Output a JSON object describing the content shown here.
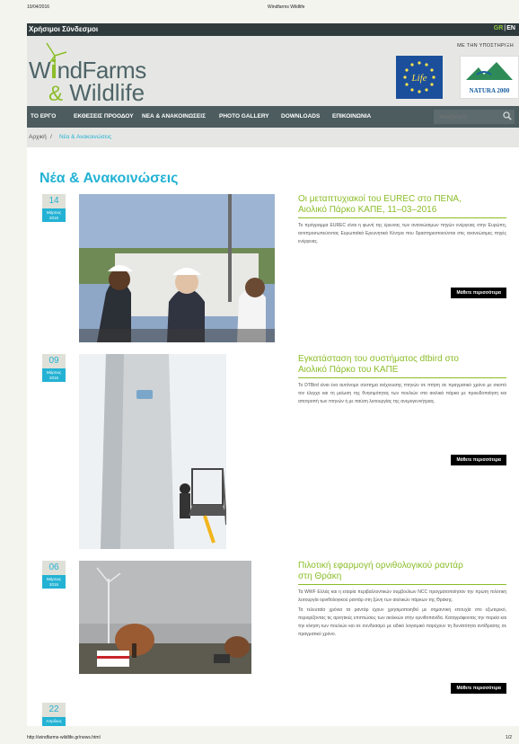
{
  "print": {
    "date": "10/04/2016",
    "title": "Windfarms Wildlife",
    "url": "http://windfarms-wildlife.gr/news.html",
    "page": "1/2"
  },
  "topbar": {
    "useful_links": "Χρήσιμοι Σύνδεσμοι",
    "lang_gr": "GR",
    "lang_sep": "|",
    "lang_en": "EN"
  },
  "brand": {
    "logo_line1_prefix": "W",
    "logo_line1_accent": "i",
    "logo_line1_rest": "ndFarms",
    "logo_line2_amp": "&",
    "logo_line2_rest": " Wildlife",
    "support_label": "ΜΕ ΤΗΝ ΥΠΟΣΤΗΡΙΞΗ",
    "eu_logo_text": "Life",
    "natura_logo_text": "NATURA 2000"
  },
  "nav": {
    "items": [
      "ΤΟ ΕΡΓΟ",
      "ΕΚΘΕΣΕΙΣ ΠΡΟΟΔΟΥ",
      "ΝΕΑ & ΑΝΑΚΟΙΝΩΣΕΙΣ",
      "PHOTO GALLERY",
      "DOWNLOADS",
      "ΕΠΙΚΟΙΝΩΝΙΑ"
    ],
    "search_placeholder": "Αναζήτηση"
  },
  "breadcrumb": {
    "home": "Αρχική",
    "sep": "/",
    "current": "Νέα & Ανακοινώσεις"
  },
  "page_title": "Νέα & Ανακοινώσεις",
  "colors": {
    "accent_blue": "#23b2d4",
    "accent_green": "#8bbd28",
    "nav_bg": "#4c5c5f",
    "topbar_bg": "#2f3a3d"
  },
  "posts": [
    {
      "day": "14",
      "month": "Μάρτιος",
      "year": "2016",
      "title_line1": "Οι μεταπτυχιακοί του EUREC στο ΠΕΝΑ,",
      "title_line2": "Αιολικό Πάρκο ΚΑΠΕ, 11–03–2016",
      "excerpt": "Το πρόγραμμα EUREC είναι η φωνή της έρευνας των ανανεώσιμων πηγών ενέργειας στην Ευρώπη, αντιπροσωπεύοντας Ευρωπαϊκά Ερευνητικά Κέντρα που δραστηριοποιούνται στις ανανεώσιμες πηγές ενέργειας.",
      "more": "Μάθετε περισσότερα"
    },
    {
      "day": "09",
      "month": "Μάρτιος",
      "year": "2016",
      "title_line1": "Εγκατάσταση του συστήματος dtbird στο",
      "title_line2": "Αιολικό Πάρκο του ΚΑΠΕ",
      "excerpt": "Το DTBird είναι ένα αυτόνομο σύστημα ανίχνευσης πτηνών σε πτήση σε πραγματικό χρόνο με σκοπό τον έλεγχο και τη μείωση της θνησιμότητας των πουλιών στα αιολικά πάρκα με προειδοποίηση και αποτροπή των πτηνών ή με παύση λειτουργίας της ανεμογεννήτριας.",
      "more": "Μάθετε περισσότερα"
    },
    {
      "day": "06",
      "month": "Μάρτιος",
      "year": "2016",
      "title_line1": "Πιλοτική εφαρμογή ορνιθολογικού ραντάρ",
      "title_line2": "στη Θράκη",
      "excerpt": "Τα WWF Ελλάς και η εταιρία περιβαλλοντικών συμβούλων NCC πραγματοποίησαν την πρώτη πιλοτική λειτουργία ορνιθολογικού ραντάρ στη ζώνη των αιολικών πάρκων της Θράκης.",
      "excerpt2": "Τα τελευταία χρόνια τα ραντάρ έχουν χρησιμοποιηθεί με σημαντική επιτυχία στο εξωτερικό, περιορίζοντας τις αρνητικές επιπτώσεις των αιολικών στην ορνιθοπανίδα. Καταγράφοντας την πορεία και την κίνηση των πουλιών και σε συνδυασμό με ειδικό λογισμικό παρέχουν τη δυνατότητα αντίδρασης σε πραγματικό χρόνο.",
      "more": "Μάθετε περισσότερα"
    },
    {
      "day": "22",
      "month": "Απρίλιος"
    }
  ]
}
